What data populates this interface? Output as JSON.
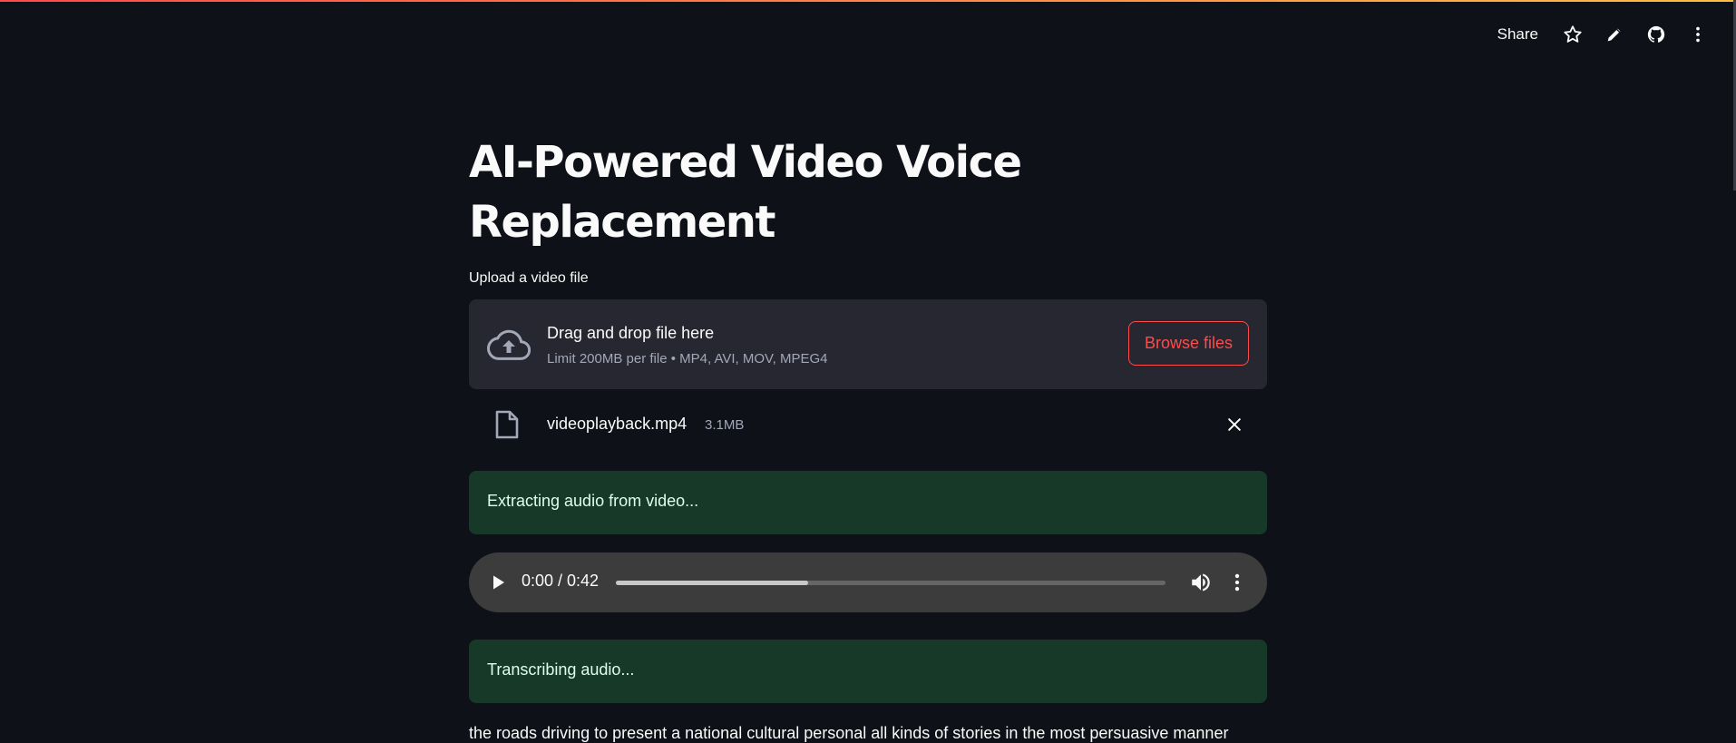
{
  "toolbar": {
    "share_label": "Share",
    "icons": [
      "star-icon",
      "pencil-icon",
      "github-icon",
      "kebab-menu-icon"
    ]
  },
  "page": {
    "title": "AI-Powered Video Voice Replacement"
  },
  "uploader": {
    "label": "Upload a video file",
    "drop_title": "Drag and drop file here",
    "drop_subtitle": "Limit 200MB per file • MP4, AVI, MOV, MPEG4",
    "browse_label": "Browse files",
    "file": {
      "name": "videoplayback.mp4",
      "size": "3.1MB"
    }
  },
  "status": {
    "extracting": "Extracting audio from video...",
    "transcribing": "Transcribing audio..."
  },
  "audio_player": {
    "time": "0:00 / 0:42",
    "buffered_fraction": 0.35
  },
  "transcript": {
    "text": "the roads driving to present a national cultural personal all kinds of stories in the most persuasive manner"
  },
  "colors": {
    "background": "#0e1117",
    "accent": "#ff4b4b",
    "success_bg": "#173928",
    "success_text": "#dffde9"
  }
}
